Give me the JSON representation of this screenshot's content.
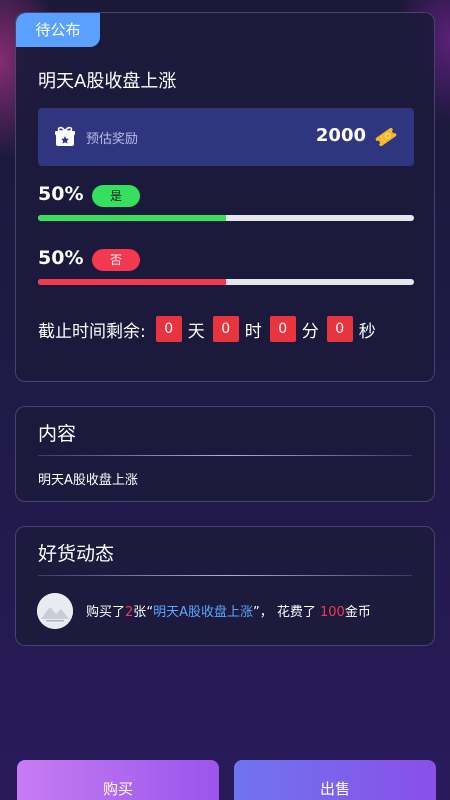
{
  "market": {
    "status_badge": "待公布",
    "title": "明天A股收盘上涨",
    "reward_label": "预估奖励",
    "reward_value": "2000",
    "yes_percent": "50%",
    "yes_label": "是",
    "yes_fraction": 0.5,
    "no_percent": "50%",
    "no_label": "否",
    "no_fraction": 0.5
  },
  "countdown": {
    "label": "截止时间剩余:",
    "days": "0",
    "days_unit": "天",
    "hours": "0",
    "hours_unit": "时",
    "minutes": "0",
    "minutes_unit": "分",
    "seconds": "0",
    "seconds_unit": "秒"
  },
  "content": {
    "heading": "内容",
    "text": "明天A股收盘上涨"
  },
  "feed": {
    "heading": "好货动态",
    "items": [
      {
        "prefix": "购买了",
        "count": "2",
        "unit": "张",
        "quote_open": "“",
        "item_name": "明天A股收盘上涨",
        "quote_close": "”，",
        "spent_label": "花费了",
        "amount": "100",
        "currency": "金币"
      }
    ]
  },
  "actions": {
    "buy_label": "购买",
    "sell_label": "出售"
  },
  "colors": {
    "yes": "#35e05e",
    "no": "#f4384f",
    "badge": "#5aa0ff",
    "link": "#5aa8ff"
  },
  "icons": {
    "reward": "gift-icon",
    "coin": "ticket-icon"
  }
}
